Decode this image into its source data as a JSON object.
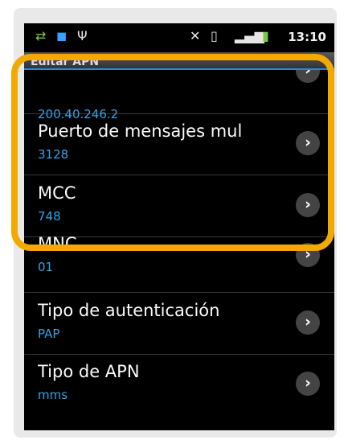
{
  "status_bar": {
    "time": "13:10",
    "icons": [
      "sync-icon",
      "notification-icon",
      "usb-icon",
      "mute-icon",
      "vibrate-icon",
      "signal-icon",
      "battery-icon"
    ]
  },
  "title_bar": {
    "title": "Editar APN"
  },
  "list": [
    {
      "title": "",
      "value": "200.40.246.2"
    },
    {
      "title": "Puerto de mensajes mul",
      "value": "3128"
    },
    {
      "title": "MCC",
      "value": "748"
    },
    {
      "title": "MNC",
      "value": "01"
    },
    {
      "title": "Tipo de autenticación",
      "value": "PAP"
    },
    {
      "title": "Tipo de APN",
      "value": "mms"
    }
  ],
  "colors": {
    "accent": "#33a3e6",
    "highlight": "#f2a900"
  }
}
